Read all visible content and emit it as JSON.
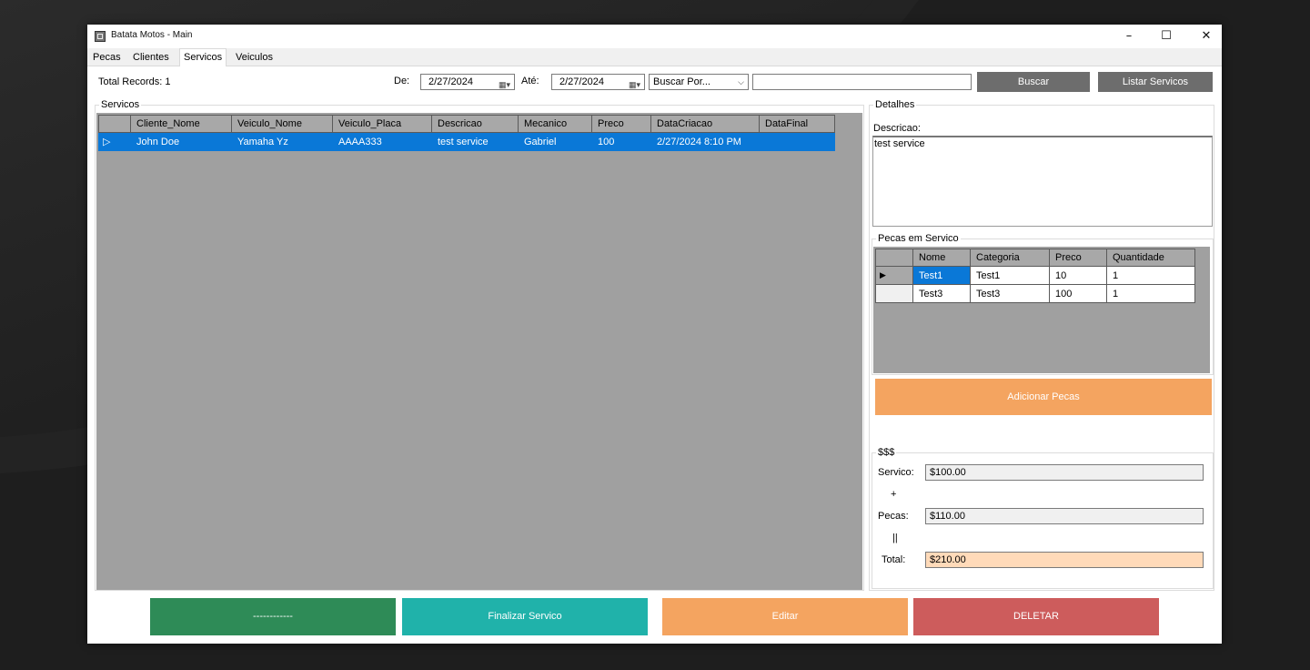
{
  "window": {
    "title": "Batata Motos - Main",
    "minimize": "–",
    "maximize": "☐",
    "close": "✕"
  },
  "tabs": [
    {
      "label": "Pecas"
    },
    {
      "label": "Clientes"
    },
    {
      "label": "Servicos",
      "active": true
    },
    {
      "label": "Veiculos"
    }
  ],
  "toolbar": {
    "total_records": "Total Records: 1",
    "de_label": "De:",
    "de_value": "2/27/2024",
    "ate_label": "Até:",
    "ate_value": "2/27/2024",
    "buscar_por": "Buscar Por...",
    "search_value": "",
    "buscar_button": "Buscar",
    "listar_button": "Listar Servicos"
  },
  "servicos": {
    "group_title": "Servicos",
    "columns": [
      "Cliente_Nome",
      "Veiculo_Nome",
      "Veiculo_Placa",
      "Descricao",
      "Mecanico",
      "Preco",
      "DataCriacao",
      "DataFinal"
    ],
    "rows": [
      [
        "John Doe",
        "Yamaha Yz",
        "AAAA333",
        "test service",
        "Gabriel",
        "100",
        "2/27/2024 8:10 PM",
        ""
      ]
    ]
  },
  "detalhes": {
    "group_title": "Detalhes",
    "descricao_label": "Descricao:",
    "descricao_value": "test service"
  },
  "pecas_em_servico": {
    "group_title": "Pecas em Servico",
    "columns": [
      "Nome",
      "Categoria",
      "Preco",
      "Quantidade"
    ],
    "rows": [
      [
        "Test1",
        "Test1",
        "10",
        "1"
      ],
      [
        "Test3",
        "Test3",
        "100",
        "1"
      ]
    ],
    "add_button": "Adicionar Pecas"
  },
  "totais": {
    "group_title": "$$$",
    "servico_label": "Servico:",
    "servico_value": "$100.00",
    "plus": "+",
    "pecas_label": "Pecas:",
    "pecas_value": "$110.00",
    "equals": "||",
    "total_label": "Total:",
    "total_value": "$210.00"
  },
  "actions": {
    "first": "------------",
    "finalizar": "Finalizar Servico",
    "editar": "Editar",
    "deletar": "DELETAR"
  },
  "colors": {
    "selection": "#0a78d7",
    "green": "#2e8b57",
    "teal": "#20b2aa",
    "orange": "#f4a460",
    "red": "#cd5c5c",
    "gray_button": "#6d6d6d",
    "total_bg": "#ffdab9"
  }
}
